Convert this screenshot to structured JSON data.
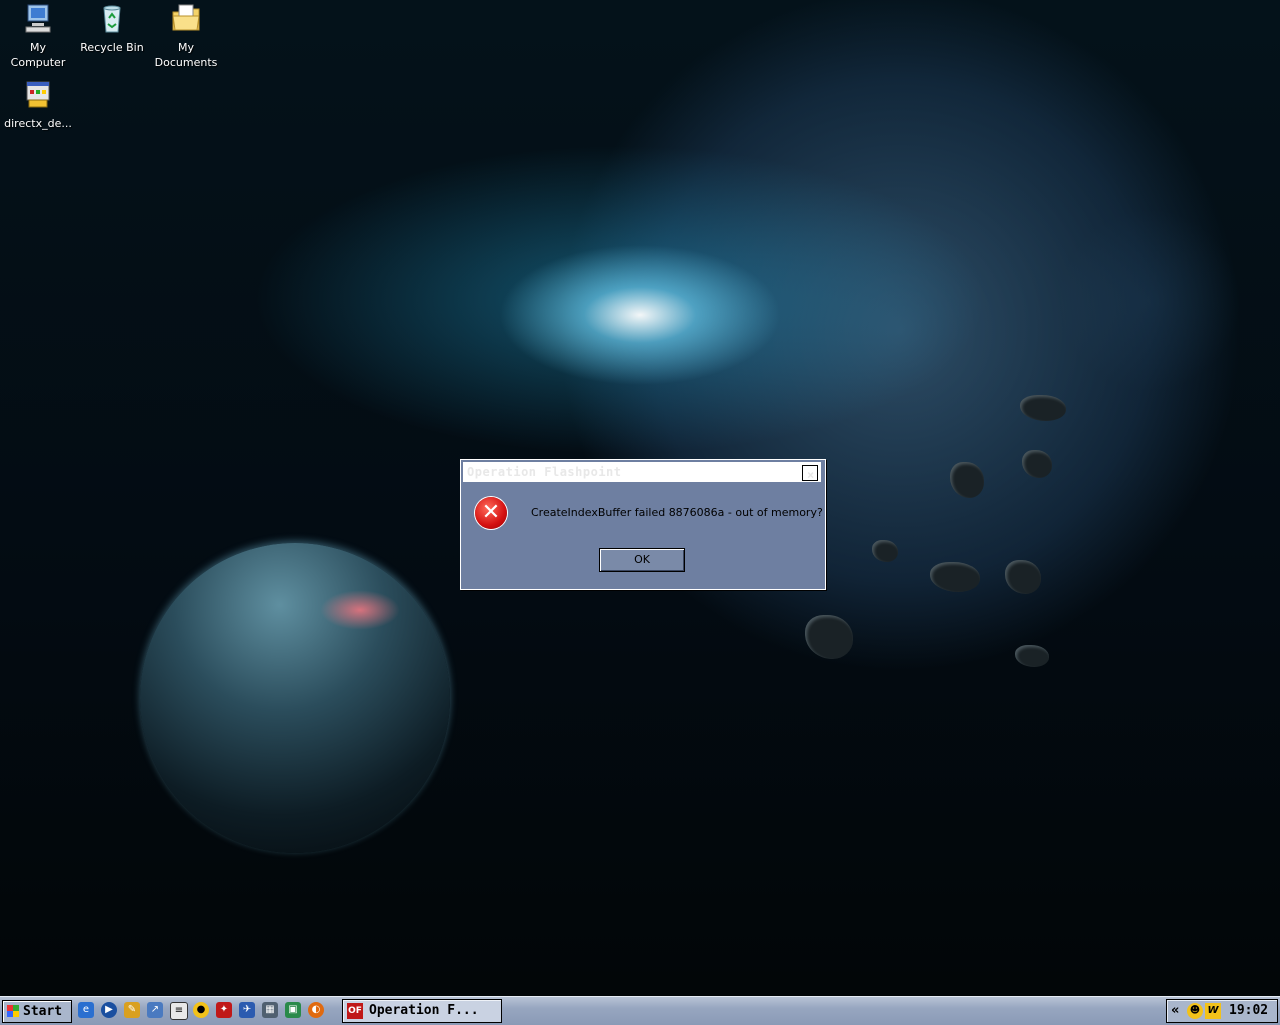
{
  "desktop": {
    "icons": [
      {
        "label": "My\nComputer",
        "icon": "my-computer-icon"
      },
      {
        "label": "Recycle Bin",
        "icon": "recycle-bin-icon"
      },
      {
        "label": "My\nDocuments",
        "icon": "my-documents-icon"
      },
      {
        "label": "directx_de...",
        "icon": "installer-icon"
      }
    ]
  },
  "dialog": {
    "title": "Operation Flashpoint",
    "close_glyph": "×",
    "icon": "error-icon",
    "error_glyph": "✕",
    "message": "CreateIndexBuffer failed 8876086a - out of memory?",
    "ok_label": "OK"
  },
  "taskbar": {
    "start_label": "Start",
    "quick_launch": [
      "ie-icon",
      "media-player-icon",
      "pencil-icon",
      "app-icon",
      "notepad-icon",
      "yellow-app-icon",
      "opflash-icon",
      "mirc-icon",
      "hardware-icon",
      "network-icon",
      "firefox-icon"
    ],
    "active_task": {
      "label": "Operation F...",
      "icon": "opflash-task-icon",
      "icon_glyph": "OF"
    },
    "tray": {
      "chevron": "«",
      "clock": "19:02",
      "tray_icons": [
        "security-icon",
        "winamp-icon"
      ],
      "winamp_glyph": "W"
    }
  },
  "colors": {
    "dialog_bg": "#6e7fa1",
    "taskbar_bg": "#97a6c0",
    "error_red": "#d41010"
  }
}
